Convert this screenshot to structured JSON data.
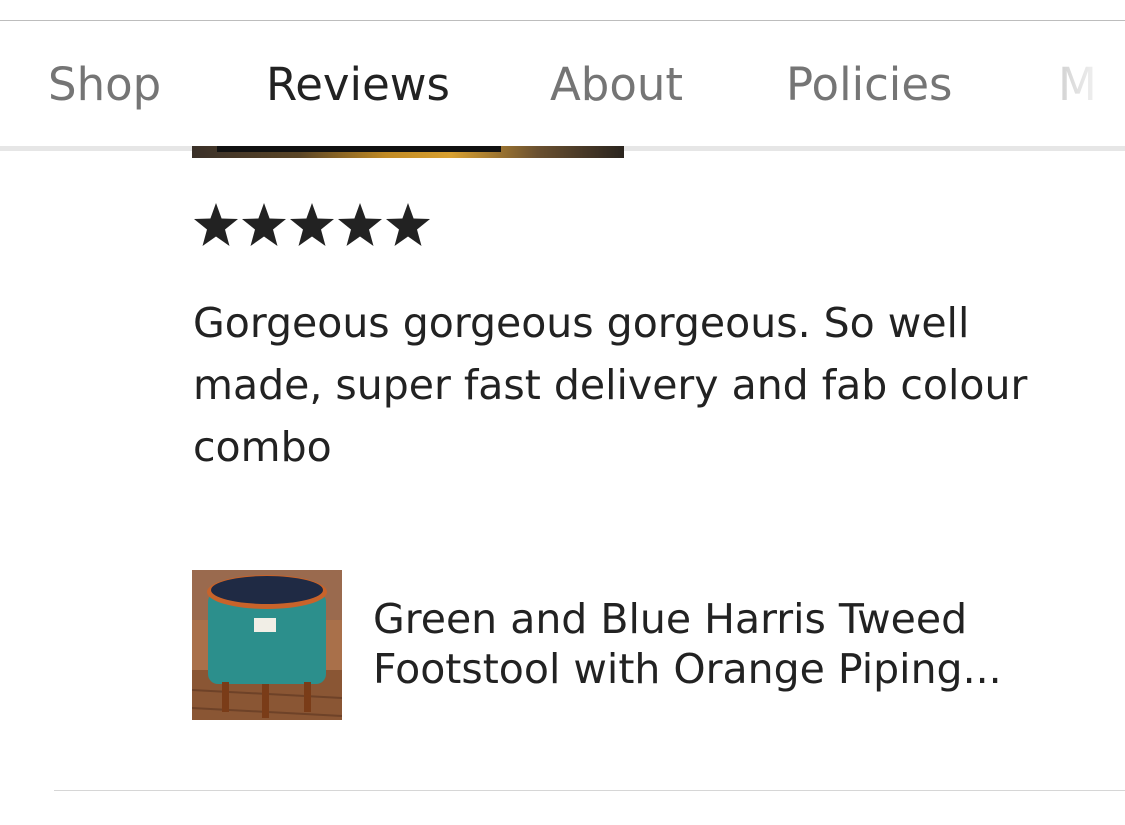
{
  "tabs": [
    {
      "label": "Shop",
      "active": false
    },
    {
      "label": "Reviews",
      "active": true
    },
    {
      "label": "About",
      "active": false
    },
    {
      "label": "Policies",
      "active": false
    },
    {
      "label": "M",
      "active": false
    }
  ],
  "review": {
    "rating": 5,
    "rating_max": 5,
    "text": "Gorgeous gorgeous gorgeous. So well made, super fast delivery and fab colour combo"
  },
  "listing": {
    "thumbnail_icon": "footstool-product-photo",
    "title": "Green and Blue Harris Tweed Footstool with Orange Piping..."
  },
  "colors": {
    "star": "#222222",
    "active_tab_underline": "#111111",
    "inactive_tab": "#757575"
  }
}
